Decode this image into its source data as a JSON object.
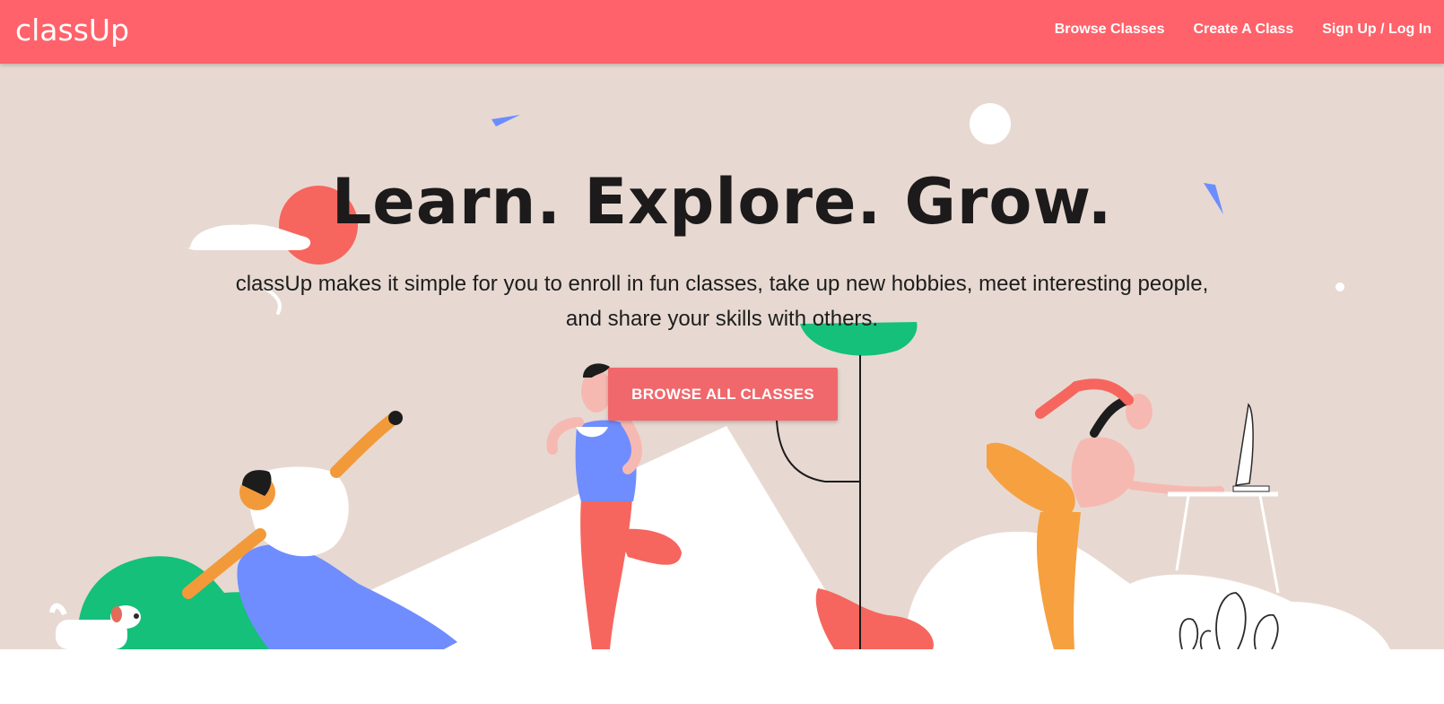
{
  "brand": {
    "logo_text": "classUp",
    "primary_color": "#ff626a",
    "hero_background": "#e7d9d1"
  },
  "nav": {
    "items": [
      {
        "label": "Browse Classes"
      },
      {
        "label": "Create A Class"
      },
      {
        "label": "Sign Up / Log In"
      }
    ]
  },
  "hero": {
    "headline": "Learn. Explore. Grow.",
    "subtext": "classUp makes it simple for you to enroll in fun classes, take up new hobbies, meet interesting people, and share your skills with others.",
    "cta_label": "BROWSE ALL CLASSES"
  },
  "illustration": {
    "figures": [
      "man-stretching",
      "dog",
      "woman-tree-pose-eating",
      "woman-dancer-pose-at-desk"
    ],
    "icons": [
      "triangle-confetti-icon",
      "circle-confetti-icon",
      "cloud-icon",
      "sun-icon",
      "plant-icon",
      "computer-monitor-icon"
    ]
  }
}
